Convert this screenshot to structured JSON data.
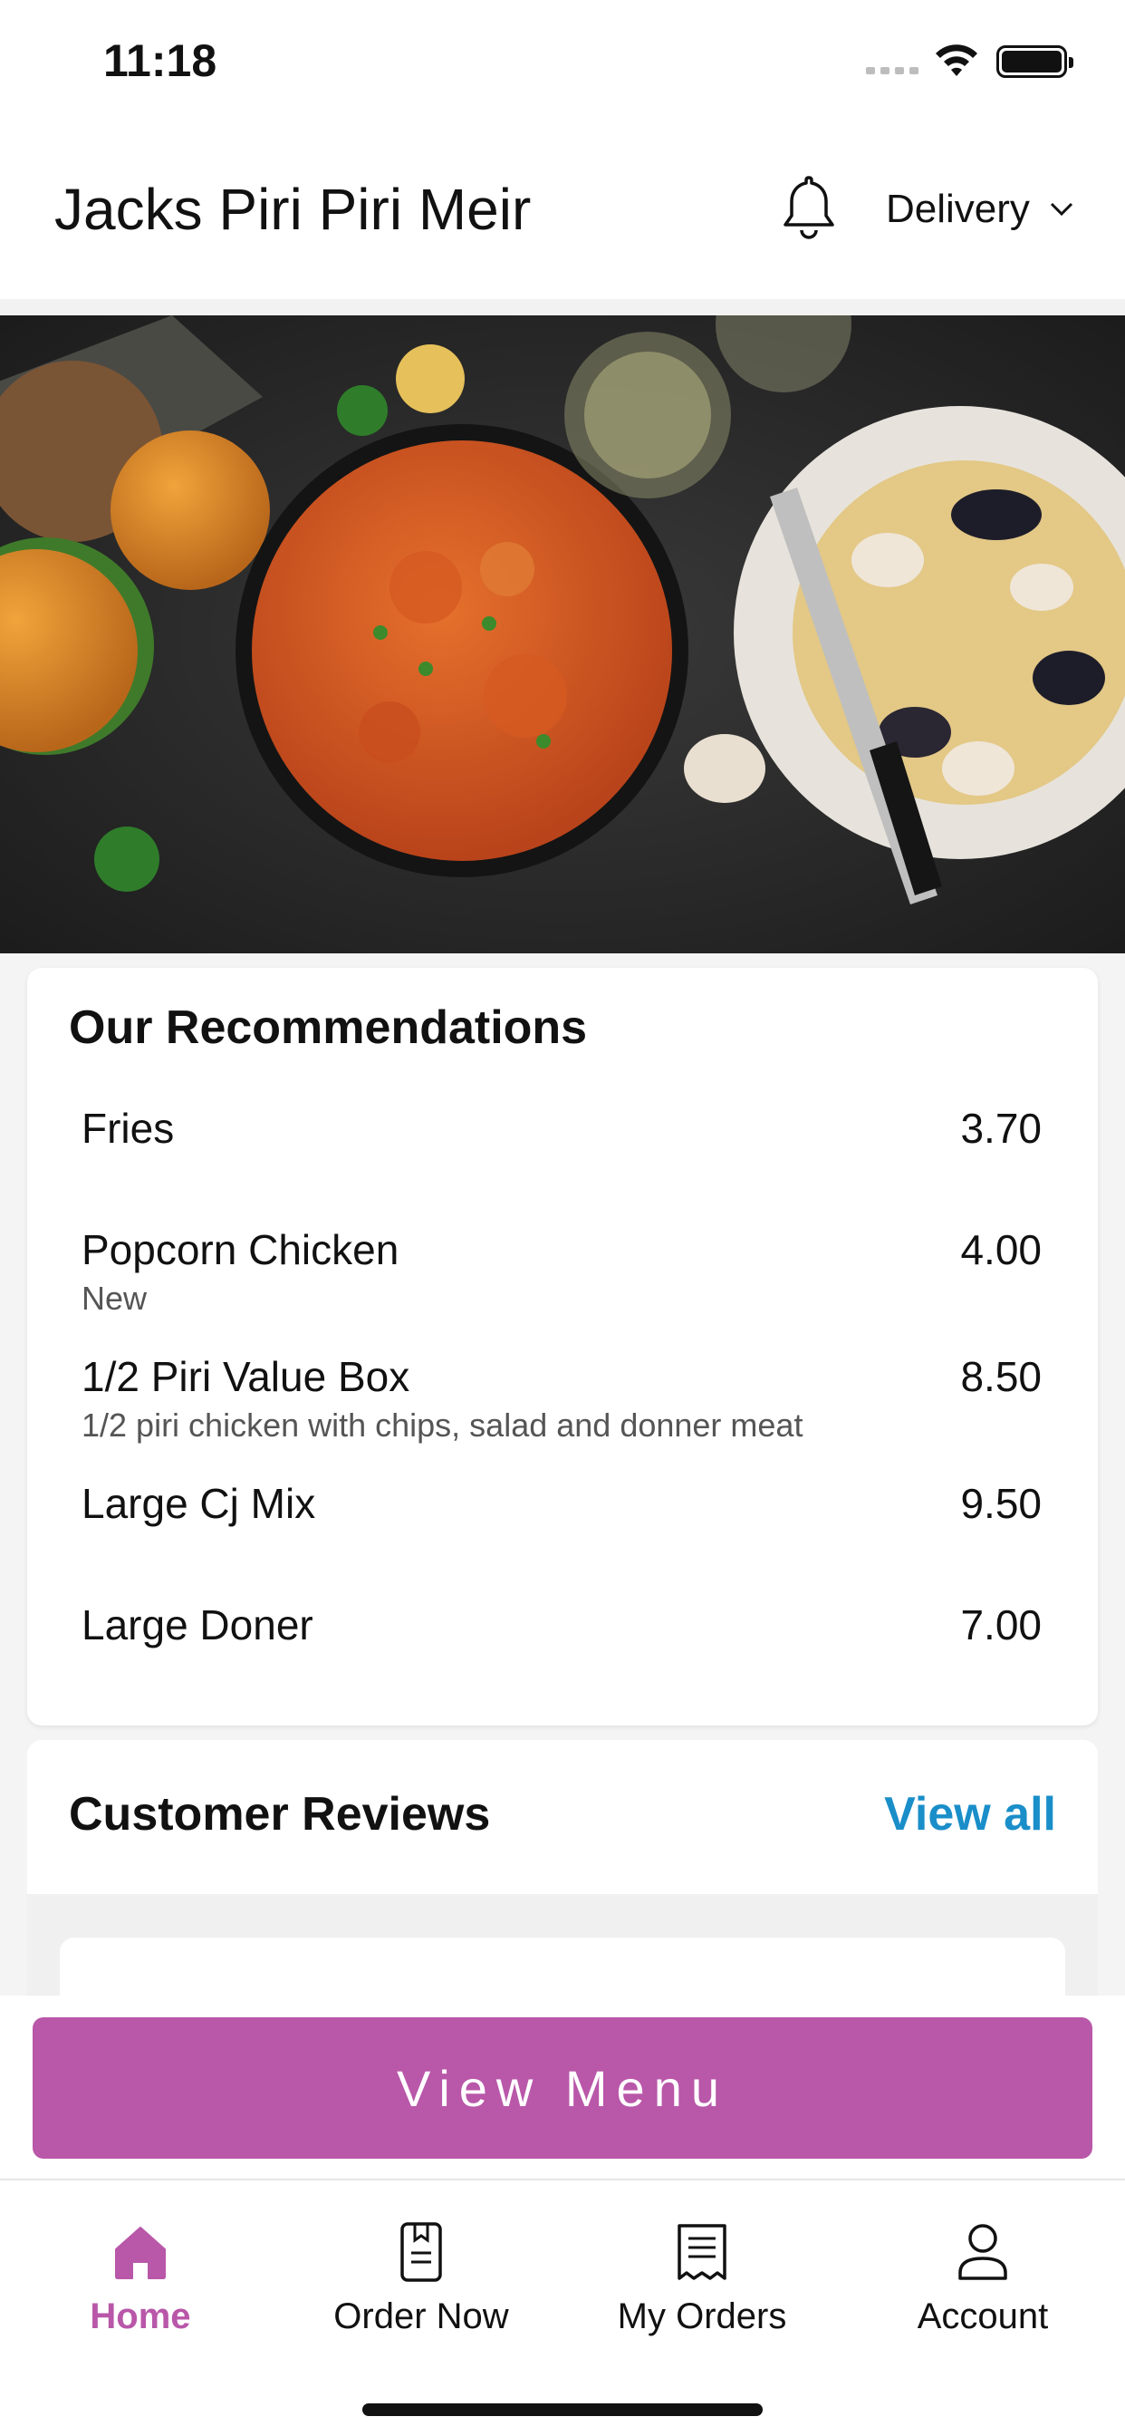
{
  "status_bar": {
    "time": "11:18"
  },
  "header": {
    "store_name": "Jacks Piri Piri Meir",
    "mode": "Delivery"
  },
  "recommendations": {
    "title": "Our Recommendations",
    "items": [
      {
        "name": "Fries",
        "description": "",
        "price": "3.70"
      },
      {
        "name": "Popcorn Chicken",
        "description": "New",
        "price": "4.00"
      },
      {
        "name": "1/2 Piri Value Box",
        "description": "1/2 piri chicken with chips, salad and donner meat",
        "price": "8.50"
      },
      {
        "name": "Large Cj Mix",
        "description": "",
        "price": "9.50"
      },
      {
        "name": "Large Doner",
        "description": "",
        "price": "7.00"
      }
    ]
  },
  "reviews": {
    "title": "Customer Reviews",
    "view_all": "View all"
  },
  "view_menu_button": "View Menu",
  "tabs": [
    {
      "label": "Home",
      "icon": "home-icon",
      "active": true
    },
    {
      "label": "Order Now",
      "icon": "menu-book-icon",
      "active": false
    },
    {
      "label": "My Orders",
      "icon": "receipt-icon",
      "active": false
    },
    {
      "label": "Account",
      "icon": "person-icon",
      "active": false
    }
  ],
  "colors": {
    "accent": "#b957a9",
    "link": "#1a8ec9"
  }
}
